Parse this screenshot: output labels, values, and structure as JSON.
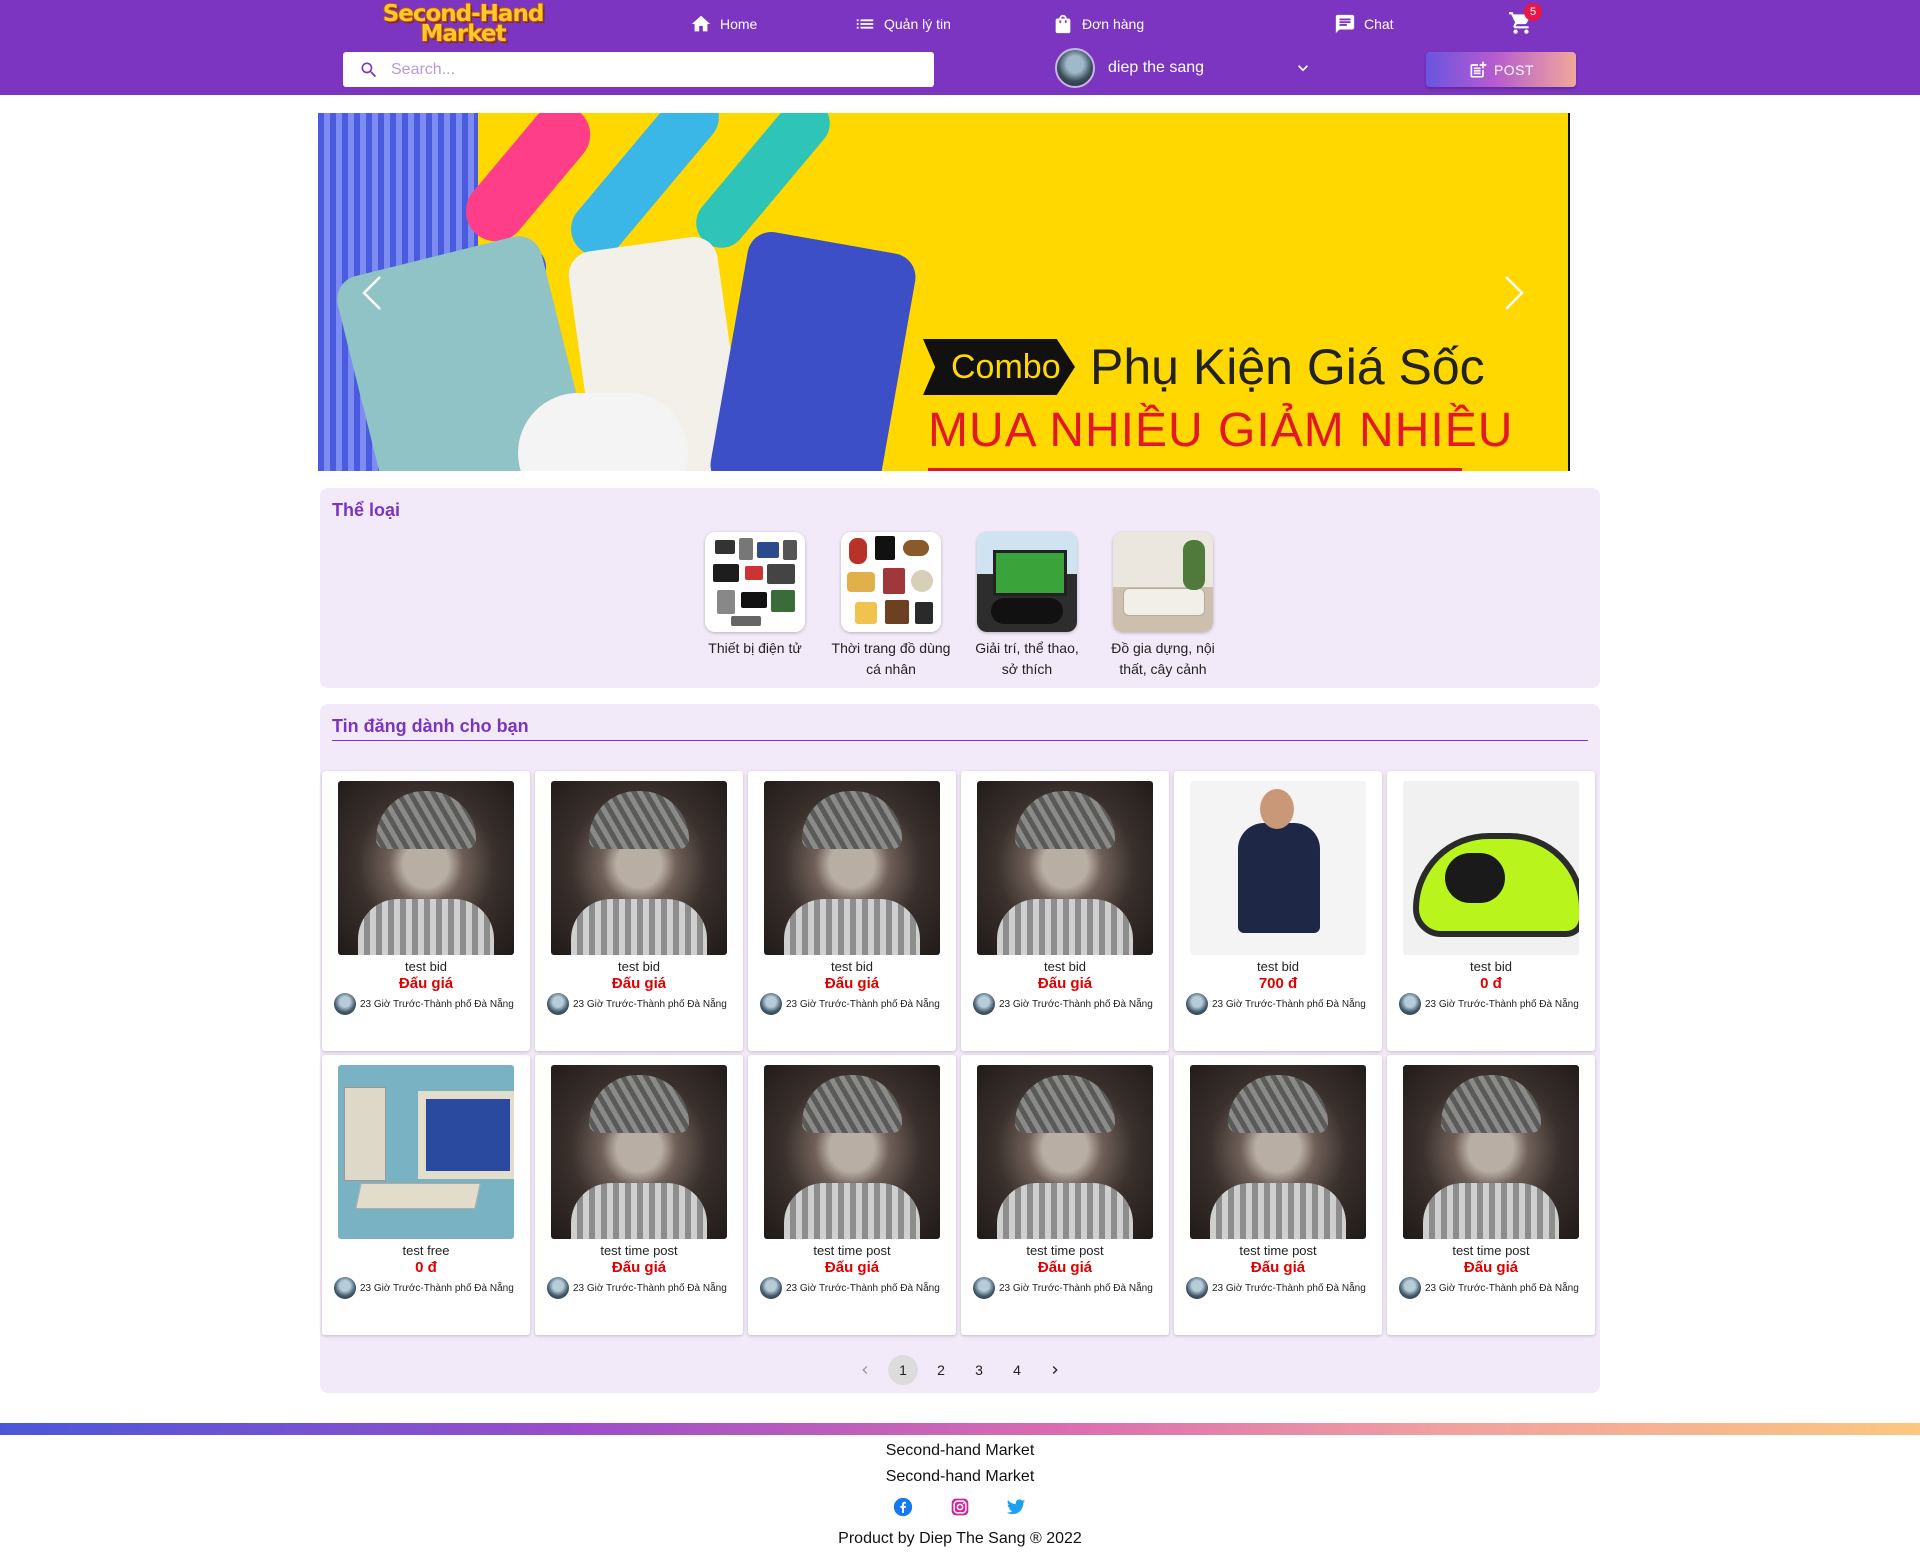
{
  "header": {
    "logo_line1": "Second-Hand",
    "logo_line2": "Market",
    "nav": [
      {
        "label": "Home",
        "icon": "home-icon"
      },
      {
        "label": "Quản lý tin",
        "icon": "list-icon"
      },
      {
        "label": "Đơn hàng",
        "icon": "shopping-bag-icon"
      },
      {
        "label": "Chat",
        "icon": "chat-icon"
      }
    ],
    "cart_count": "5",
    "search_placeholder": "Search...",
    "user_name": "diep the sang",
    "post_label": "POST",
    "colors": {
      "bar": "#7b35c0",
      "badge": "#e8174a"
    }
  },
  "banner": {
    "combo": "Combo",
    "title": "Phụ Kiện Giá Sốc",
    "subtitle": "MUA NHIỀU GIẢM NHIỀU"
  },
  "categories": {
    "title": "Thể loại",
    "items": [
      {
        "label": "Thiết bị điện tử"
      },
      {
        "label": "Thời trang đồ dùng cá nhân"
      },
      {
        "label": "Giải trí, thể thao, sở thích"
      },
      {
        "label": "Đồ gia dựng, nội thất, cây cảnh"
      }
    ]
  },
  "posts": {
    "title": "Tin đăng dành cho bạn",
    "items": [
      {
        "title": "test bid",
        "price": "Đấu giá",
        "meta": "23 Giờ Trước-Thành phố Đà Nẵng",
        "image": "boy"
      },
      {
        "title": "test bid",
        "price": "Đấu giá",
        "meta": "23 Giờ Trước-Thành phố Đà Nẵng",
        "image": "boy"
      },
      {
        "title": "test bid",
        "price": "Đấu giá",
        "meta": "23 Giờ Trước-Thành phố Đà Nẵng",
        "image": "boy"
      },
      {
        "title": "test bid",
        "price": "Đấu giá",
        "meta": "23 Giờ Trước-Thành phố Đà Nẵng",
        "image": "boy"
      },
      {
        "title": "test bid",
        "price": "700 đ",
        "meta": "23 Giờ Trước-Thành phố Đà Nẵng",
        "image": "shirt"
      },
      {
        "title": "test bid",
        "price": "0 đ",
        "meta": "23 Giờ Trước-Thành phố Đà Nẵng",
        "image": "tent"
      },
      {
        "title": "test free",
        "price": "0 đ",
        "meta": "23 Giờ Trước-Thành phố Đà Nẵng",
        "image": "pc"
      },
      {
        "title": "test time post",
        "price": "Đấu giá",
        "meta": "23 Giờ Trước-Thành phố Đà Nẵng",
        "image": "boy"
      },
      {
        "title": "test time post",
        "price": "Đấu giá",
        "meta": "23 Giờ Trước-Thành phố Đà Nẵng",
        "image": "boy"
      },
      {
        "title": "test time post",
        "price": "Đấu giá",
        "meta": "23 Giờ Trước-Thành phố Đà Nẵng",
        "image": "boy"
      },
      {
        "title": "test time post",
        "price": "Đấu giá",
        "meta": "23 Giờ Trước-Thành phố Đà Nẵng",
        "image": "boy"
      },
      {
        "title": "test time post",
        "price": "Đấu giá",
        "meta": "23 Giờ Trước-Thành phố Đà Nẵng",
        "image": "boy"
      }
    ]
  },
  "pagination": {
    "pages": [
      "1",
      "2",
      "3",
      "4"
    ],
    "current": "1"
  },
  "footer": {
    "line1": "Second-hand Market",
    "line2": "Second-hand Market",
    "social": [
      "facebook-icon",
      "instagram-icon",
      "twitter-icon"
    ],
    "credit": "Product by Diep The Sang ® 2022"
  }
}
